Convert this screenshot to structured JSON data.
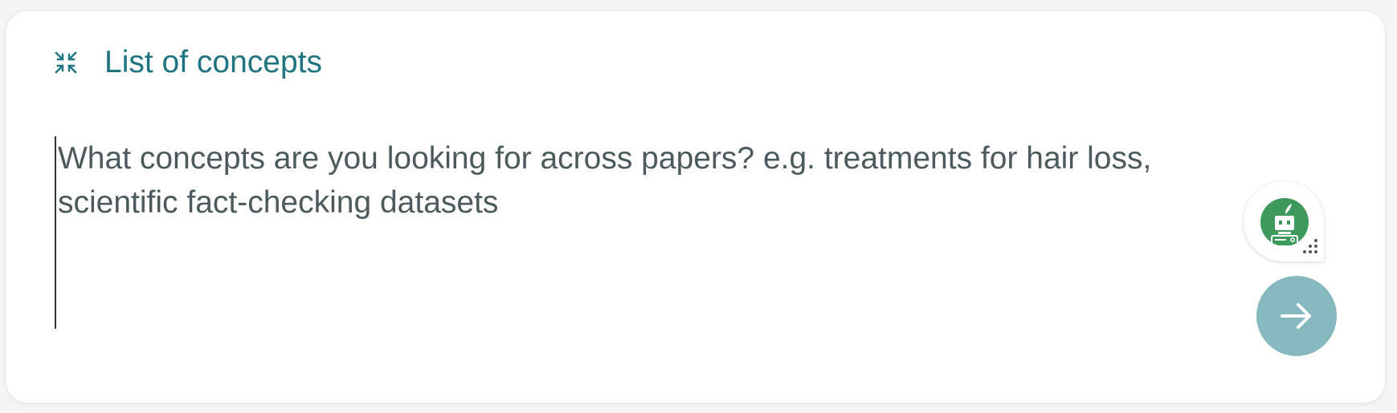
{
  "panel": {
    "title": "List of concepts",
    "collapse_icon": "collapse-icon"
  },
  "query": {
    "value": "",
    "placeholder": "What concepts are you looking for across papers? e.g. treatments for hair loss, scientific fact-checking datasets"
  },
  "assistant": {
    "icon": "robot-icon",
    "drag_icon": "drag-handle-icon"
  },
  "submit": {
    "icon": "arrow-right-icon"
  },
  "colors": {
    "accent": "#1f7480",
    "submit_bg": "#86b8c0",
    "assistant_bg": "#3e9a5c",
    "text": "#4c5a5e"
  }
}
